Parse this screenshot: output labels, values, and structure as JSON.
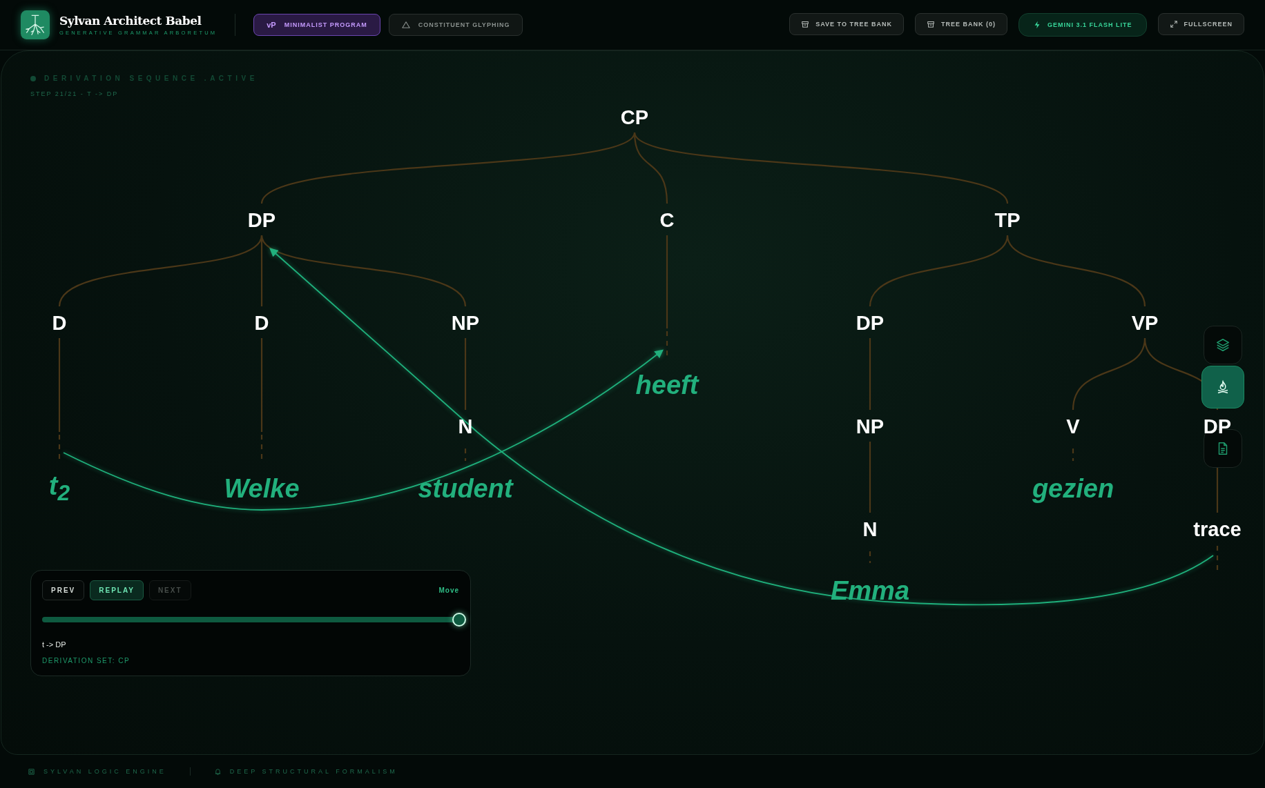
{
  "header": {
    "title": "Sylvan Architect Babel",
    "subtitle": "GENERATIVE GRAMMAR ARBORETUM",
    "modes": [
      {
        "badge": "vP",
        "label": "MINIMALIST PROGRAM",
        "selected": true
      },
      {
        "label": "CONSTITUENT GLYPHING",
        "selected": false
      }
    ],
    "actions": [
      {
        "kind": "save",
        "label": "SAVE TO TREE BANK"
      },
      {
        "kind": "bank",
        "label": "TREE BANK (0)"
      },
      {
        "kind": "model",
        "label": "GEMINI 3.1 FLASH LITE"
      },
      {
        "kind": "fullscreen",
        "label": "FULLSCREEN"
      }
    ]
  },
  "status": {
    "title": "DERIVATION SEQUENCE .ACTIVE",
    "step": "STEP 21/21 - T -> DP"
  },
  "tree": {
    "label": "CP",
    "kind": "node",
    "children": [
      {
        "label": "DP",
        "kind": "node",
        "children": [
          {
            "label": "D",
            "kind": "node",
            "children": [
              {
                "label": "t$_{2}$",
                "kind": "word"
              }
            ]
          },
          {
            "label": "D",
            "kind": "node",
            "children": [
              {
                "label": "Welke",
                "kind": "word"
              }
            ]
          },
          {
            "label": "NP",
            "kind": "node",
            "children": [
              {
                "label": "N",
                "kind": "node",
                "children": [
                  {
                    "label": "student",
                    "kind": "word"
                  }
                ]
              }
            ]
          }
        ]
      },
      {
        "label": "C",
        "kind": "node",
        "children": [
          {
            "label": "heeft",
            "kind": "word"
          }
        ]
      },
      {
        "label": "TP",
        "kind": "node",
        "children": [
          {
            "label": "DP",
            "kind": "node",
            "children": [
              {
                "label": "NP",
                "kind": "node",
                "children": [
                  {
                    "label": "N",
                    "kind": "node",
                    "children": [
                      {
                        "label": "Emma",
                        "kind": "word"
                      }
                    ]
                  }
                ]
              }
            ]
          },
          {
            "label": "VP",
            "kind": "node",
            "children": [
              {
                "label": "V",
                "kind": "node",
                "children": [
                  {
                    "label": "gezien",
                    "kind": "word"
                  }
                ]
              },
              {
                "label": "DP",
                "kind": "node",
                "children": [
                  {
                    "label": "trace",
                    "kind": "node"
                  }
                ]
              }
            ]
          }
        ]
      }
    ]
  },
  "player": {
    "buttons": [
      {
        "label": "PREV",
        "selected": false,
        "disabled": false
      },
      {
        "label": "REPLAY",
        "selected": true,
        "disabled": false
      },
      {
        "label": "NEXT",
        "selected": false,
        "disabled": true
      }
    ],
    "mode": "Move",
    "level": 1.0,
    "rule": "t -> DP",
    "set": "DERIVATION SET: CP"
  },
  "tools": [
    {
      "kind": "layers",
      "selected": false
    },
    {
      "kind": "campfire",
      "selected": true
    },
    {
      "kind": "document",
      "selected": false
    }
  ],
  "footer": [
    {
      "kind": "engine",
      "label": "SYLVAN LOGIC ENGINE"
    },
    {
      "kind": "formalism",
      "label": "DEEP STRUCTURAL FORMALISM"
    }
  ]
}
